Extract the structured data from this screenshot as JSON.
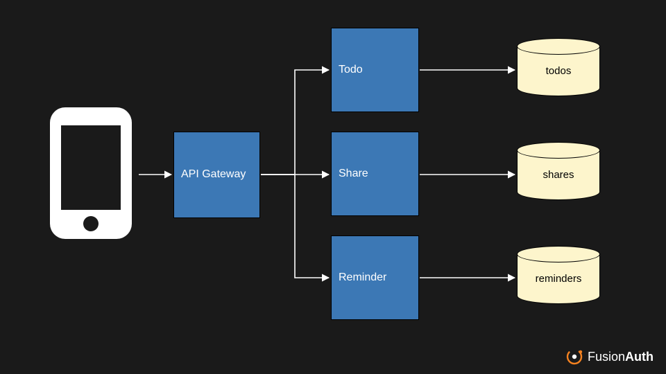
{
  "gateway": {
    "label": "API Gateway"
  },
  "services": {
    "todo": {
      "label": "Todo"
    },
    "share": {
      "label": "Share"
    },
    "reminder": {
      "label": "Reminder"
    }
  },
  "databases": {
    "todos": {
      "label": "todos"
    },
    "shares": {
      "label": "shares"
    },
    "reminders": {
      "label": "reminders"
    }
  },
  "brand": {
    "part1": "Fusion",
    "part2": "Auth"
  },
  "colors": {
    "service_fill": "#3c78b5",
    "db_fill": "#fdf5cc",
    "bg": "#1a1a1a",
    "arrow": "#ffffff",
    "brand_accent": "#f58220"
  },
  "chart_data": {
    "type": "diagram",
    "title": "",
    "nodes": [
      {
        "id": "phone",
        "type": "client",
        "label": ""
      },
      {
        "id": "gateway",
        "type": "service",
        "label": "API Gateway"
      },
      {
        "id": "todo",
        "type": "service",
        "label": "Todo"
      },
      {
        "id": "share",
        "type": "service",
        "label": "Share"
      },
      {
        "id": "reminder",
        "type": "service",
        "label": "Reminder"
      },
      {
        "id": "todos_db",
        "type": "database",
        "label": "todos"
      },
      {
        "id": "shares_db",
        "type": "database",
        "label": "shares"
      },
      {
        "id": "reminders_db",
        "type": "database",
        "label": "reminders"
      }
    ],
    "edges": [
      {
        "from": "phone",
        "to": "gateway"
      },
      {
        "from": "gateway",
        "to": "todo"
      },
      {
        "from": "gateway",
        "to": "share"
      },
      {
        "from": "gateway",
        "to": "reminder"
      },
      {
        "from": "todo",
        "to": "todos_db"
      },
      {
        "from": "share",
        "to": "shares_db"
      },
      {
        "from": "reminder",
        "to": "reminders_db"
      }
    ]
  }
}
